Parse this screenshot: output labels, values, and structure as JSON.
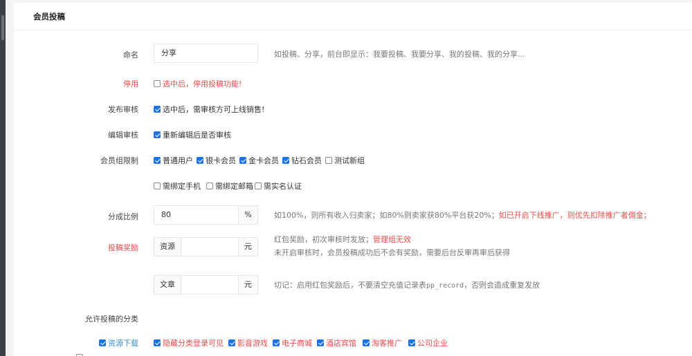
{
  "panel": {
    "title": "会员投稿"
  },
  "name_field": {
    "label": "命名",
    "value": "分享",
    "hint": "如投稿、分享，前台即显示：我要投稿、我要分享、我的投稿、我的分享..."
  },
  "disable": {
    "label": "停用",
    "checked": false,
    "text": "选中后，停用投稿功能!"
  },
  "publish_review": {
    "label": "发布审核",
    "checked": true,
    "text": "选中后，需审核方可上线销售!"
  },
  "edit_review": {
    "label": "编辑审核",
    "checked": true,
    "text": "重新编辑后是否审核"
  },
  "member_groups": {
    "label": "会员组限制",
    "options": [
      {
        "text": "普通用户",
        "checked": true
      },
      {
        "text": "银卡会员",
        "checked": true
      },
      {
        "text": "金卡会员",
        "checked": true
      },
      {
        "text": "钻石会员",
        "checked": true
      },
      {
        "text": "测试新组",
        "checked": false
      }
    ],
    "options2": [
      {
        "text": "需绑定手机",
        "checked": false
      },
      {
        "text": "需绑定邮箱",
        "checked": false
      },
      {
        "text": "需实名认证",
        "checked": false
      }
    ]
  },
  "share_ratio": {
    "label": "分成比例",
    "value": "80",
    "unit": "%",
    "hint_gray": "如100%，则所有收入归卖家；如80%则卖家获80%平台获20%；",
    "hint_red": "如已开启下线推广，则优先扣除推广者佣金；"
  },
  "reward": {
    "label": "投稿奖励",
    "resource_prefix": "资源",
    "resource_value": "",
    "resource_unit": "元",
    "hint1_gray": "红包奖励，初次审核时发放；",
    "hint1_red": "管理组无效",
    "hint2": "未开启审核时，会员投稿成功后不会有奖励，需要后台反审再审后获得",
    "article_prefix": "文章",
    "article_value": "",
    "article_unit": "元",
    "hint3_a": "切记：启用红包奖励后，不要清空充值记录表",
    "hint3_code": "pp_record",
    "hint3_b": "，否则会造成重复发放"
  },
  "categories": {
    "label": "允许投稿的分类",
    "parent": {
      "text": "资源下载",
      "checked": true
    },
    "children": [
      {
        "text": "隐藏分类登录可见",
        "checked": true
      },
      {
        "text": "影音游戏",
        "checked": true
      },
      {
        "text": "电子商城",
        "checked": true
      },
      {
        "text": "酒店宾馆",
        "checked": true
      },
      {
        "text": "淘客推广",
        "checked": true
      },
      {
        "text": "公司企业",
        "checked": true
      }
    ]
  },
  "colors": {
    "accent": "#1a73e8",
    "danger": "#e84b4b",
    "link": "#3a8fd8"
  }
}
